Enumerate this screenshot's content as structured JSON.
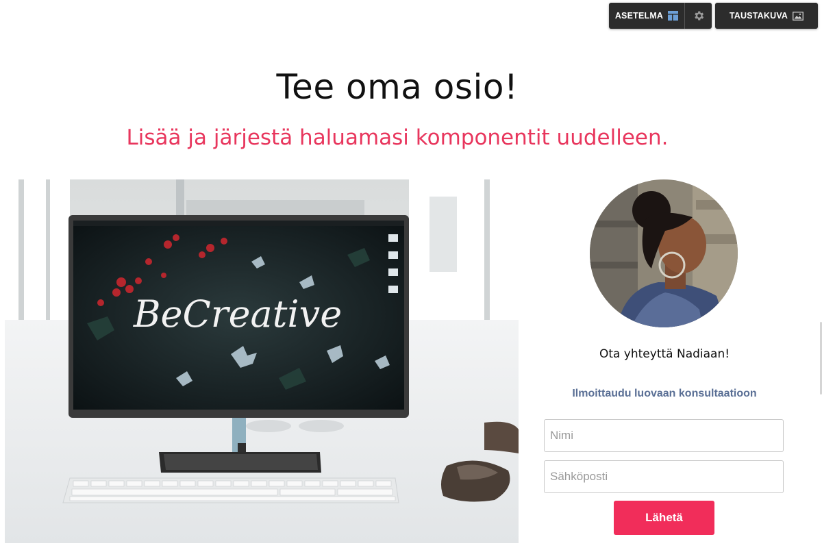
{
  "toolbar": {
    "layout_label": "ASETELMA",
    "layout_icon": "layout-icon",
    "settings_icon": "gear-icon",
    "background_label": "TAUSTAKUVA",
    "background_icon": "image-icon",
    "bg_color": "#2c2c2c"
  },
  "section": {
    "title": "Tee oma osio!",
    "subtitle": "Lisää ja järjestä haluamasi komponentit uudelleen.",
    "subtitle_color": "#e8365d"
  },
  "hero": {
    "screen_text": "BeCreative"
  },
  "contact": {
    "title": "Ota yhteyttä Nadiaan!",
    "subtitle": "Ilmoittaudu luovaan konsultaatioon",
    "name_placeholder": "Nimi",
    "email_placeholder": "Sähköposti",
    "submit_label": "Lähetä",
    "accent": "#f12d5a"
  }
}
